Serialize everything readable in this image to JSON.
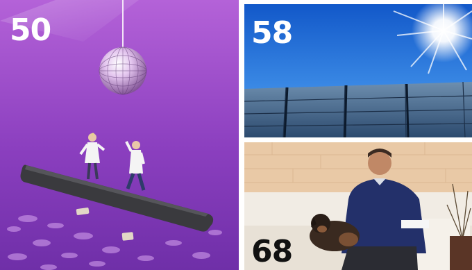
{
  "pages": [
    {
      "number": "50",
      "topic": "disco",
      "bg": "#9b4fc6"
    },
    {
      "number": "58",
      "topic": "solar",
      "bg": "#1f6fd6"
    },
    {
      "number": "68",
      "topic": "portrait",
      "bg": "#e8c7a3"
    }
  ]
}
